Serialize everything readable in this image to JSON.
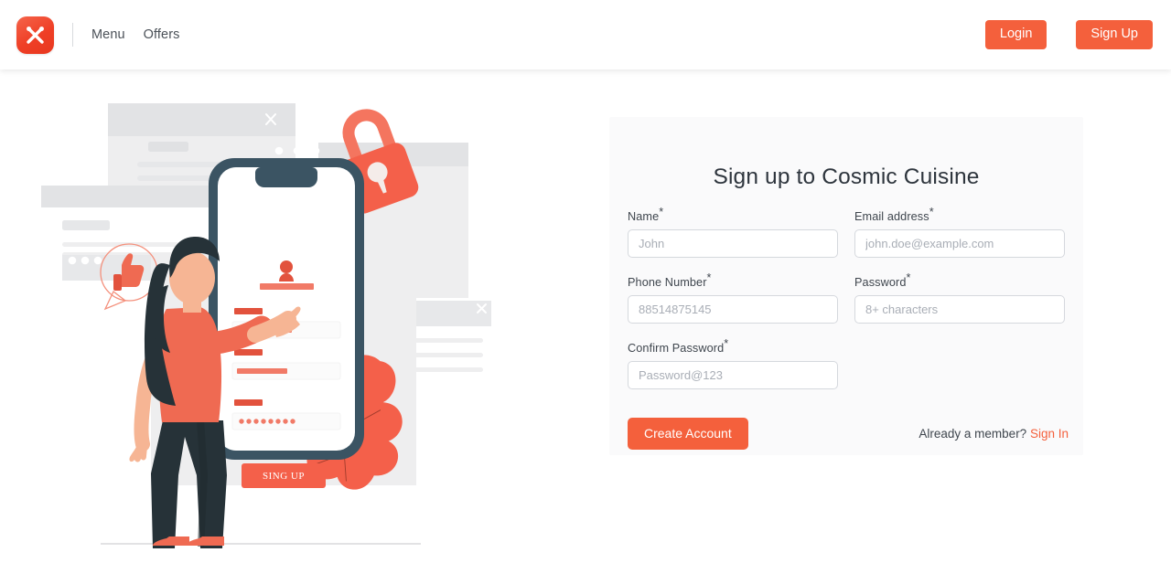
{
  "header": {
    "logo_icon": "crossed-utensils-icon",
    "nav": [
      {
        "label": "Menu"
      },
      {
        "label": "Offers"
      }
    ],
    "login_label": "Login",
    "signup_label": "Sign Up"
  },
  "colors": {
    "accent": "#f4603c",
    "logo_red": "#ef3f26",
    "coral": "#f4755f",
    "coral_dark": "#ee6352",
    "navy": "#3b5463",
    "skin": "#f6b594",
    "hair": "#263238",
    "text_dark": "#2e353d",
    "label": "#3f464e",
    "placeholder": "#a9aeb6",
    "border": "#d5d8dd",
    "card_bg": "#fafafb",
    "illus_gray": "#e2e3e5",
    "illus_gray_light": "#eeeeef"
  },
  "illustration": {
    "name": "signup-illustration",
    "phone_screen": {
      "button_label": "SING UP",
      "avatar_icon": "user-avatar-icon"
    },
    "lock_icon": "padlock-icon",
    "leaf_icon": "leaf-icon",
    "thumbs_up_icon": "thumbs-up-icon",
    "close_icon": "close-icon",
    "person": "woman-pointing-at-phone"
  },
  "form": {
    "title": "Sign up to Cosmic Cuisine",
    "fields": [
      {
        "label": "Name",
        "required": "*",
        "placeholder": "John",
        "value": "",
        "name": "name"
      },
      {
        "label": "Email address",
        "required": "*",
        "placeholder": "john.doe@example.com",
        "value": "",
        "name": "email"
      },
      {
        "label": "Phone Number",
        "required": "*",
        "placeholder": "88514875145",
        "value": "",
        "name": "phone"
      },
      {
        "label": "Password",
        "required": "*",
        "placeholder": "8+ characters",
        "value": "",
        "name": "password"
      },
      {
        "label": "Confirm Password",
        "required": "*",
        "placeholder": "Password@123",
        "value": "",
        "name": "confirm-password"
      }
    ],
    "submit_label": "Create Account",
    "member_prompt": "Already a member?",
    "signin_label": "Sign In"
  }
}
